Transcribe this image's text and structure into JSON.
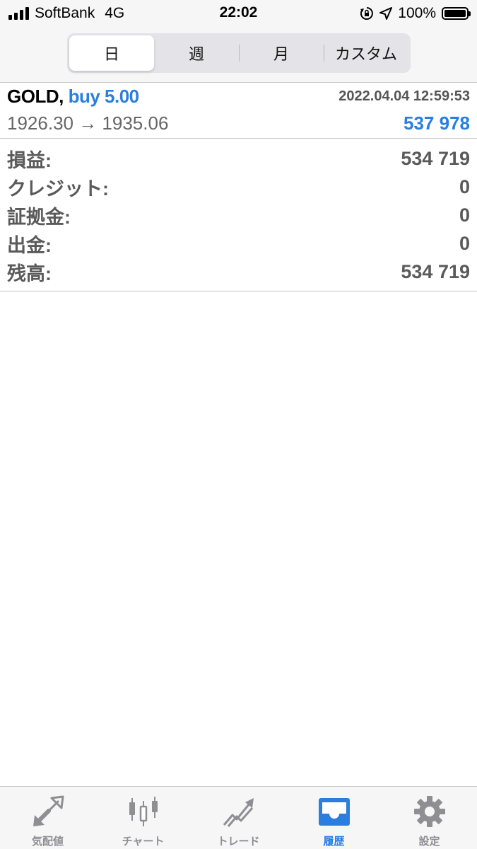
{
  "status_bar": {
    "carrier": "SoftBank",
    "network": "4G",
    "time": "22:02",
    "battery_percent": "100%"
  },
  "segments": {
    "items": [
      {
        "label": "日",
        "active": true
      },
      {
        "label": "週",
        "active": false
      },
      {
        "label": "月",
        "active": false
      },
      {
        "label": "カスタム",
        "active": false
      }
    ]
  },
  "deal": {
    "symbol": "GOLD,",
    "type_volume": "buy 5.00",
    "datetime": "2022.04.04 12:59:53",
    "prices": "1926.30 → 1935.06",
    "profit": "537 978"
  },
  "summary": {
    "rows": [
      {
        "label": "損益:",
        "value": "534 719"
      },
      {
        "label": "クレジット:",
        "value": "0"
      },
      {
        "label": "証拠金:",
        "value": "0"
      },
      {
        "label": "出金:",
        "value": "0"
      },
      {
        "label": "残高:",
        "value": "534 719"
      }
    ]
  },
  "tabbar": {
    "items": [
      {
        "label": "気配値",
        "icon": "quotes-arrows-icon"
      },
      {
        "label": "チャート",
        "icon": "candlestick-chart-icon"
      },
      {
        "label": "トレード",
        "icon": "trade-trend-icon"
      },
      {
        "label": "履歴",
        "icon": "history-inbox-icon"
      },
      {
        "label": "設定",
        "icon": "gear-icon"
      }
    ],
    "active_index": 3
  },
  "colors": {
    "accent_blue": "#2a7ee0",
    "inactive_gray": "#8e8e93",
    "text_gray": "#5a5a5a"
  }
}
